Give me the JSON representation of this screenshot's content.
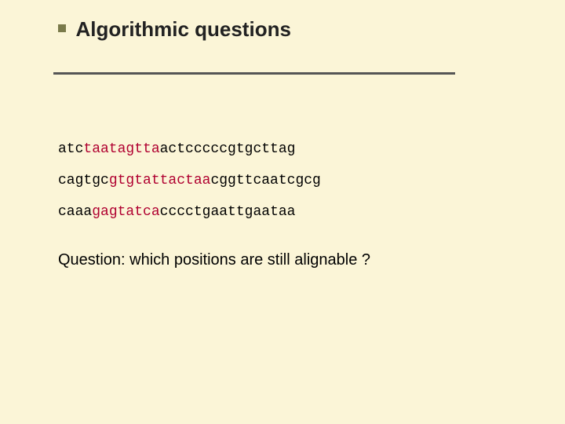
{
  "title": "Algorithmic questions",
  "seq1": {
    "p1": "atc",
    "h1": "taatagtta",
    "p2": "actcccccgtgcttag"
  },
  "seq2": {
    "p1": "cagtgc",
    "h1": "gtgtattactaa",
    "p2": "cggttcaatcgcg"
  },
  "seq3": {
    "p1": "caaa",
    "h1": "gagtatca",
    "p2": "cccctgaattgaataa"
  },
  "question": "Question: which positions are still alignable ?"
}
